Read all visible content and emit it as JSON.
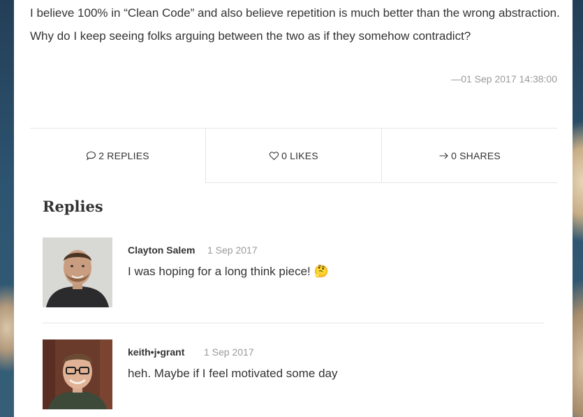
{
  "post": {
    "text": "I believe 100% in “Clean Code” and also believe repetition is much better than the wrong abstraction. Why do I keep seeing folks arguing between the two as if they somehow contradict?",
    "timestamp": "—01 Sep 2017 14:38:00"
  },
  "actions": [
    {
      "label": "2 REPLIES",
      "icon": "speech-bubble-icon"
    },
    {
      "label": "0 LIKES",
      "icon": "heart-icon"
    },
    {
      "label": "0 SHARES",
      "icon": "arrow-right-icon"
    }
  ],
  "replies_title": "Replies",
  "replies": [
    {
      "author": "Clayton Salem",
      "date": "1 Sep 2017",
      "text": "I was hoping for a long think piece! 🤔"
    },
    {
      "author": "keith•j•grant",
      "date": "1 Sep 2017",
      "text": "heh. Maybe if I feel motivated some day"
    }
  ]
}
